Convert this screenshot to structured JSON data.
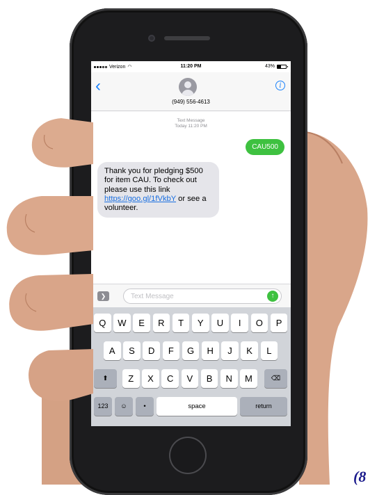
{
  "status_bar": {
    "carrier": "Verizon",
    "time": "11:20 PM",
    "battery": "43%",
    "battery_level": 0.43,
    "signal_icon": "signal-dots-icon",
    "wifi_icon": "wifi-icon"
  },
  "header": {
    "back_icon": "chevron-left-icon",
    "contact_icon": "contact-avatar-icon",
    "phone_number": "(949) 556-4613",
    "info_icon": "info-icon"
  },
  "thread": {
    "meta_line_1": "Text Message",
    "meta_line_2": "Today 11:20 PM",
    "messages": [
      {
        "direction": "outgoing",
        "text": "CAU500"
      },
      {
        "direction": "incoming",
        "text_before_link": "Thank you for pledging $500 for item CAU. To check out please use this link ",
        "link": "https://goo.gl/1fVkbY",
        "text_after_link": " or see a volunteer."
      }
    ]
  },
  "composer": {
    "apps_icon": "apps-chevron-icon",
    "placeholder": "Text Message",
    "value": "",
    "send_icon": "send-arrow-icon"
  },
  "keyboard": {
    "row1": [
      "Q",
      "W",
      "E",
      "R",
      "T",
      "Y",
      "U",
      "I",
      "O",
      "P"
    ],
    "row2": [
      "A",
      "S",
      "D",
      "F",
      "G",
      "H",
      "J",
      "K",
      "L"
    ],
    "row3": [
      "Z",
      "X",
      "C",
      "V",
      "B",
      "N",
      "M"
    ],
    "shift_icon": "shift-icon",
    "delete_icon": "delete-icon",
    "numbers_label": "123",
    "emoji_icon": "emoji-icon",
    "mic_icon": "microphone-icon",
    "space_label": "space",
    "return_label": "return"
  },
  "corner_text": "(8",
  "colors": {
    "imessage_green": "#3ec140",
    "ios_blue": "#1a82fb",
    "incoming_bubble": "#e5e5ea",
    "keyboard_bg": "#d1d4d9",
    "phone_body": "#1c1c1e",
    "corner_text": "#1a1a8c"
  }
}
